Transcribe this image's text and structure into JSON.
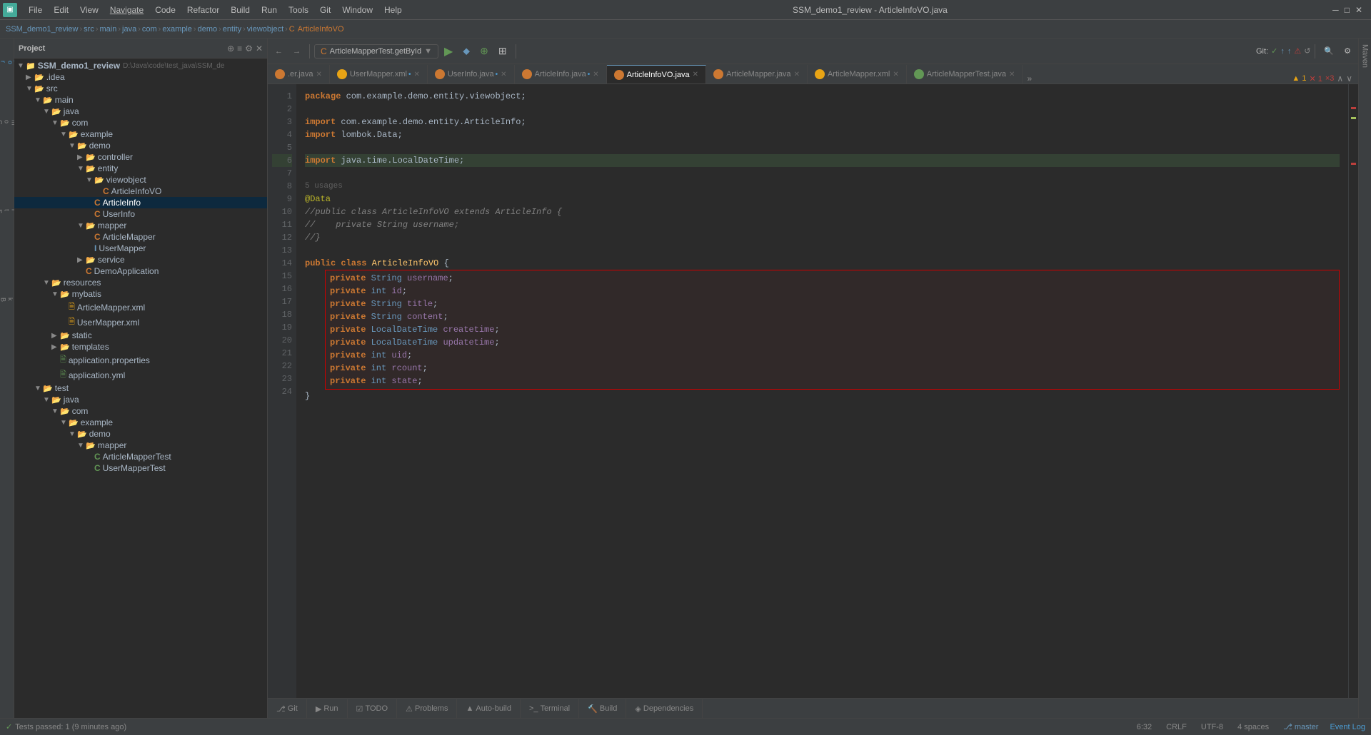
{
  "menubar": {
    "app_icon": "■",
    "items": [
      "File",
      "Edit",
      "View",
      "Navigate",
      "Code",
      "Refactor",
      "Build",
      "Run",
      "Tools",
      "Git",
      "Window",
      "Help"
    ],
    "title": "SSM_demo1_review - ArticleInfoVO.java"
  },
  "breadcrumb": {
    "items": [
      "SSM_demo1_review",
      "src",
      "main",
      "java",
      "com",
      "example",
      "demo",
      "entity",
      "viewobject"
    ],
    "current": "ArticleInfoVO"
  },
  "toolbar": {
    "run_config": "ArticleMapperTest.getById",
    "git_label": "Git:"
  },
  "tabs": [
    {
      "label": ".er.java",
      "icon_color": "#cc7832",
      "active": false,
      "modified": false
    },
    {
      "label": "UserMapper.xml",
      "icon_color": "#e8a415",
      "active": false,
      "modified": true
    },
    {
      "label": "UserInfo.java",
      "icon_color": "#cc7832",
      "active": false,
      "modified": true
    },
    {
      "label": "ArticleInfo.java",
      "icon_color": "#cc7832",
      "active": false,
      "modified": true
    },
    {
      "label": "ArticleInfoVO.java",
      "icon_color": "#cc7832",
      "active": true,
      "modified": false
    },
    {
      "label": "ArticleMapper.java",
      "icon_color": "#cc7832",
      "active": false,
      "modified": false
    },
    {
      "label": "ArticleMapper.xml",
      "icon_color": "#e8a415",
      "active": false,
      "modified": false
    },
    {
      "label": "ArticleMapperTest.java",
      "icon_color": "#cc7832",
      "active": false,
      "modified": false
    }
  ],
  "code": {
    "package": "package com.example.demo.entity.viewobject;",
    "imports": [
      "import com.example.demo.entity.ArticleInfo;",
      "import lombok.Data;",
      "",
      "import java.time.LocalDateTime;"
    ],
    "usages": "5 usages",
    "annotation": "@Data",
    "commented_class": "//public class ArticleInfoVO extends ArticleInfo {",
    "comment1": "//    private String username;",
    "comment2": "//}",
    "class_decl": "public class ArticleInfoVO {",
    "fields": [
      "private String username;",
      "private int id;",
      "private String title;",
      "private String content;",
      "private LocalDateTime createtime;",
      "private LocalDateTime updatetime;",
      "private int uid;",
      "private int rcount;",
      "private int state;"
    ],
    "closing": "}"
  },
  "project": {
    "title": "Project",
    "root": "SSM_demo1_review",
    "root_path": "D:\\Java\\code\\test_java\\SSM_de",
    "tree": [
      {
        "label": ".idea",
        "type": "folder",
        "depth": 1,
        "expanded": false
      },
      {
        "label": "src",
        "type": "folder",
        "depth": 1,
        "expanded": true
      },
      {
        "label": "main",
        "type": "folder",
        "depth": 2,
        "expanded": true
      },
      {
        "label": "java",
        "type": "folder",
        "depth": 3,
        "expanded": true
      },
      {
        "label": "com",
        "type": "folder",
        "depth": 4,
        "expanded": true
      },
      {
        "label": "example",
        "type": "folder",
        "depth": 5,
        "expanded": true
      },
      {
        "label": "demo",
        "type": "folder",
        "depth": 6,
        "expanded": true
      },
      {
        "label": "controller",
        "type": "folder",
        "depth": 7,
        "expanded": false
      },
      {
        "label": "entity",
        "type": "folder",
        "depth": 7,
        "expanded": true
      },
      {
        "label": "viewobject",
        "type": "folder",
        "depth": 8,
        "expanded": true
      },
      {
        "label": "ArticleInfoVO",
        "type": "java",
        "depth": 9,
        "expanded": false,
        "selected": false
      },
      {
        "label": "ArticleInfo",
        "type": "java",
        "depth": 8,
        "expanded": false,
        "selected": true
      },
      {
        "label": "UserInfo",
        "type": "java",
        "depth": 8,
        "expanded": false,
        "selected": false
      },
      {
        "label": "mapper",
        "type": "folder",
        "depth": 7,
        "expanded": true
      },
      {
        "label": "ArticleMapper",
        "type": "java",
        "depth": 8,
        "expanded": false,
        "selected": false
      },
      {
        "label": "UserMapper",
        "type": "java",
        "depth": 8,
        "expanded": false,
        "selected": false
      },
      {
        "label": "service",
        "type": "folder",
        "depth": 7,
        "expanded": false
      },
      {
        "label": "DemoApplication",
        "type": "java",
        "depth": 7,
        "expanded": false,
        "selected": false
      },
      {
        "label": "resources",
        "type": "folder",
        "depth": 3,
        "expanded": true
      },
      {
        "label": "mybatis",
        "type": "folder",
        "depth": 4,
        "expanded": true
      },
      {
        "label": "ArticleMapper.xml",
        "type": "xml",
        "depth": 5,
        "expanded": false
      },
      {
        "label": "UserMapper.xml",
        "type": "xml",
        "depth": 5,
        "expanded": false
      },
      {
        "label": "static",
        "type": "folder",
        "depth": 4,
        "expanded": false
      },
      {
        "label": "templates",
        "type": "folder",
        "depth": 4,
        "expanded": false
      },
      {
        "label": "application.properties",
        "type": "props",
        "depth": 4,
        "expanded": false
      },
      {
        "label": "application.yml",
        "type": "yml",
        "depth": 4,
        "expanded": false
      },
      {
        "label": "test",
        "type": "folder",
        "depth": 2,
        "expanded": true
      },
      {
        "label": "java",
        "type": "folder",
        "depth": 3,
        "expanded": true
      },
      {
        "label": "com",
        "type": "folder",
        "depth": 4,
        "expanded": true
      },
      {
        "label": "example",
        "type": "folder",
        "depth": 5,
        "expanded": true
      },
      {
        "label": "demo",
        "type": "folder",
        "depth": 6,
        "expanded": true
      },
      {
        "label": "mapper",
        "type": "folder",
        "depth": 7,
        "expanded": true
      },
      {
        "label": "ArticleMapperTest",
        "type": "java-test",
        "depth": 8,
        "expanded": false
      },
      {
        "label": "UserMapperTest",
        "type": "java-test",
        "depth": 8,
        "expanded": false
      }
    ]
  },
  "bottom_tabs": [
    {
      "label": "Git",
      "active": false
    },
    {
      "label": "Run",
      "active": false
    },
    {
      "label": "TODO",
      "active": false
    },
    {
      "label": "Problems",
      "active": false
    },
    {
      "label": "Auto-build",
      "active": false
    },
    {
      "label": "Terminal",
      "active": false
    },
    {
      "label": "Build",
      "active": false
    },
    {
      "label": "Dependencies",
      "active": false
    }
  ],
  "statusbar": {
    "test_result": "Tests passed: 1 (9 minutes ago)",
    "position": "6:32",
    "line_ending": "CRLF",
    "encoding": "UTF-8",
    "indent": "4 spaces",
    "branch": "master",
    "warnings": "▲ 1  ✕ 1  ×3"
  },
  "right_panel": {
    "label": "Maven"
  }
}
